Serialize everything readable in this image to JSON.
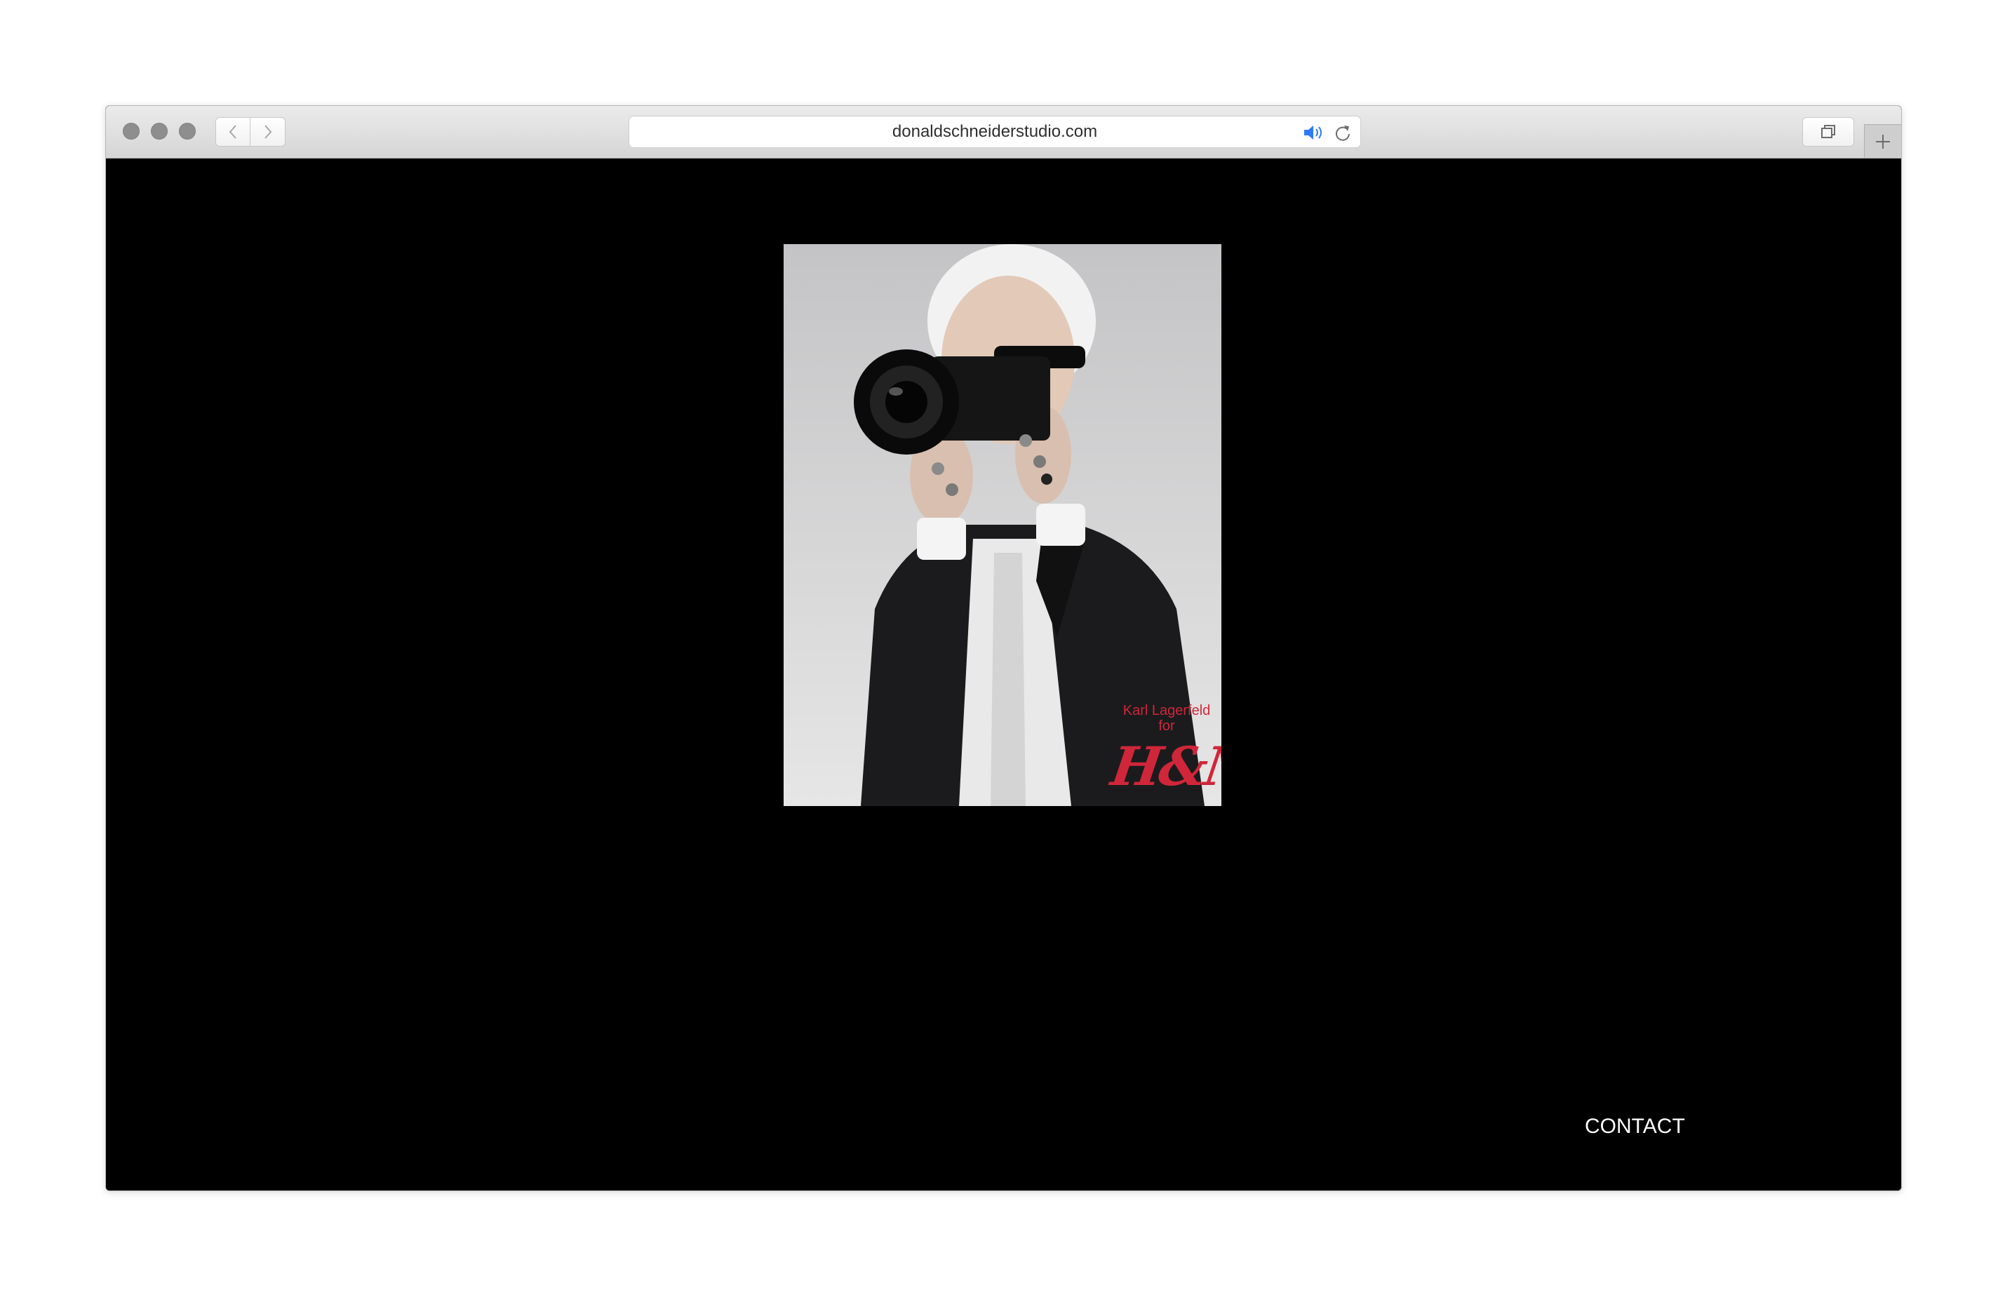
{
  "browser": {
    "url": "donaldschneiderstudio.com",
    "icons": {
      "audio": "speaker-icon",
      "reload": "reload-icon",
      "back": "chevron-left-icon",
      "forward": "chevron-right-icon",
      "tabs": "tabs-overview-icon",
      "new_tab": "plus-icon"
    },
    "colors": {
      "audio_accent": "#2f7bf5"
    }
  },
  "page": {
    "hero_image": {
      "caption_line1": "Karl Lagerfeld",
      "caption_line2": "for",
      "brand": "H&M"
    },
    "nav": {
      "contact_label": "CONTACT"
    },
    "colors": {
      "background": "#000000",
      "brand_red": "#d0263a"
    }
  }
}
